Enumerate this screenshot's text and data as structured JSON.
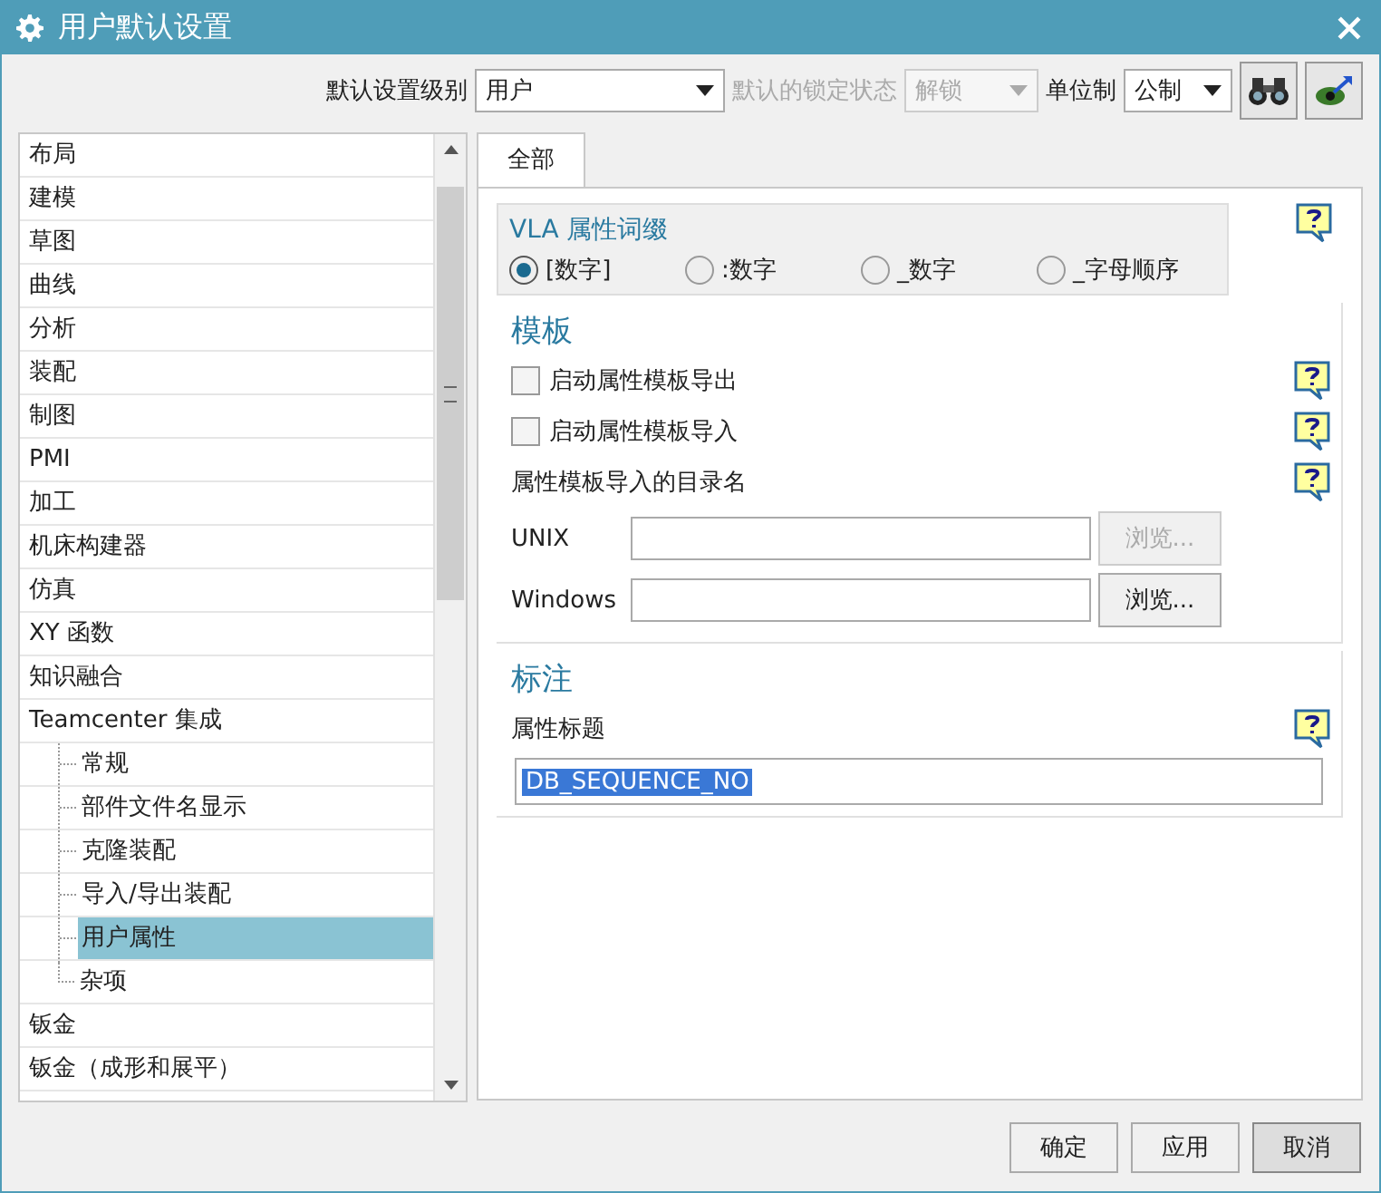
{
  "window": {
    "title": "用户默认设置"
  },
  "toolbar": {
    "level_label": "默认设置级别",
    "level_value": "用户",
    "lock_label": "默认的锁定状态",
    "lock_value": "解锁",
    "lock_disabled": true,
    "unit_label": "单位制",
    "unit_value": "公制"
  },
  "tree": [
    {
      "label": "布局",
      "selected": false
    },
    {
      "label": "建模",
      "selected": false
    },
    {
      "label": "草图",
      "selected": false
    },
    {
      "label": "曲线",
      "selected": false
    },
    {
      "label": "分析",
      "selected": false
    },
    {
      "label": "装配",
      "selected": false
    },
    {
      "label": "制图",
      "selected": false
    },
    {
      "label": "PMI",
      "selected": false
    },
    {
      "label": "加工",
      "selected": false
    },
    {
      "label": "机床构建器",
      "selected": false
    },
    {
      "label": "仿真",
      "selected": false
    },
    {
      "label": "XY 函数",
      "selected": false
    },
    {
      "label": "知识融合",
      "selected": false
    },
    {
      "label": "Teamcenter 集成",
      "selected": false,
      "children": [
        {
          "label": "常规",
          "selected": false
        },
        {
          "label": "部件文件名显示",
          "selected": false
        },
        {
          "label": "克隆装配",
          "selected": false
        },
        {
          "label": "导入/导出装配",
          "selected": false
        },
        {
          "label": "用户属性",
          "selected": true
        },
        {
          "label": "杂项",
          "selected": false
        }
      ]
    },
    {
      "label": "钣金",
      "selected": false
    },
    {
      "label": "钣金（成形和展平）",
      "selected": false
    }
  ],
  "tabs": [
    {
      "label": "全部",
      "selected": true
    }
  ],
  "vla": {
    "title": "VLA 属性词缀",
    "options": [
      {
        "label": "[数字]",
        "selected": true
      },
      {
        "label": ":数字",
        "selected": false
      },
      {
        "label": "_数字",
        "selected": false
      },
      {
        "label": "_字母顺序",
        "selected": false
      }
    ]
  },
  "template": {
    "title": "模板",
    "checks": [
      {
        "label": "启动属性模板导出",
        "checked": false
      },
      {
        "label": "启动属性模板导入",
        "checked": false
      }
    ],
    "dir_label": "属性模板导入的目录名",
    "paths": [
      {
        "label": "UNIX",
        "button": "浏览...",
        "disabled": true
      },
      {
        "label": "Windows",
        "button": "浏览...",
        "disabled": false
      }
    ]
  },
  "annotation": {
    "title": "标注",
    "field_label": "属性标题",
    "value": "DB_SEQUENCE_NO"
  },
  "buttons": [
    {
      "label": "确定"
    },
    {
      "label": "应用"
    },
    {
      "label": "取消"
    }
  ]
}
